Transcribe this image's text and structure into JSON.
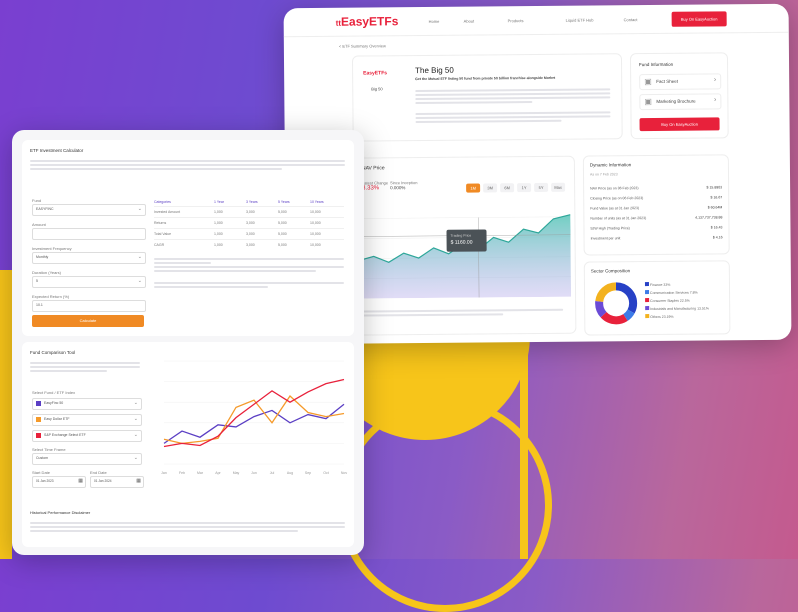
{
  "brand": {
    "name": "EasyETFs",
    "prefix": "tt"
  },
  "nav": {
    "items": [
      "Home",
      "About",
      "Products",
      "Liquid ETF Hub",
      "Contact"
    ],
    "cta": "Buy On EasyAuction"
  },
  "breadcrumb": "< ETF Summary Overview",
  "fund": {
    "logo_text": "EasyETFs",
    "ticker": "Big 50",
    "title": "The Big 50",
    "subtitle": "Get the Mutual ETF listing 50 fund from private 50 billion franchise alongside Market"
  },
  "fund_info": {
    "title": "Fund Information",
    "links": [
      "Fact Sheet",
      "Marketing Brochure"
    ],
    "cta": "Buy On EasyAuction"
  },
  "price_panel": {
    "title": "NAV Price",
    "stats": [
      {
        "label": "Latest Change",
        "value": "3.33%"
      },
      {
        "label": "Since Inception",
        "value": "0.000%"
      }
    ],
    "ranges": [
      "1M",
      "3M",
      "6M",
      "1Y",
      "5Y",
      "Max"
    ],
    "tooltip_label": "Trading Price",
    "tooltip_value": "$ 1160.00"
  },
  "dynamic_info": {
    "title": "Dynamic Information",
    "date": "As on 7 Feb 2023",
    "rows": [
      {
        "label": "NAV Price (as on 06 Feb 2023)",
        "value": "$ 15.8903"
      },
      {
        "label": "Closing Price (as on 06 Feb 2023)",
        "value": "$ 16.67"
      },
      {
        "label": "Fund Value (as at 31 Jan 2023)",
        "value": "$ 60.64M"
      },
      {
        "label": "Number of units (as at 31 Jan 2023)",
        "value": "4,137,737,738.88"
      },
      {
        "label": "52W High (Trading Price)",
        "value": "$ 16.43"
      },
      {
        "label": "Investment per unit",
        "value": "$ 4.16"
      }
    ]
  },
  "sector": {
    "title": "Sector Composition",
    "items": [
      {
        "label": "Finance",
        "value": "33%",
        "color": "#2741c6"
      },
      {
        "label": "Communication Services",
        "value": "7.8%",
        "color": "#3c7be8"
      },
      {
        "label": "Consumer Staples",
        "value": "22.5%",
        "color": "#e8213b"
      },
      {
        "label": "Industrials and Manufacturing",
        "value": "13.51%",
        "color": "#6b4bd6"
      },
      {
        "label": "Others",
        "value": "23.19%",
        "color": "#f3b21f"
      }
    ]
  },
  "calculator": {
    "title": "ETF Investment Calculator",
    "fields": [
      {
        "label": "Fund",
        "value": "EASYFINC"
      },
      {
        "label": "Amount",
        "value": ""
      },
      {
        "label": "Investment Frequency",
        "value": "Monthly"
      },
      {
        "label": "Duration (Years)",
        "value": "5"
      },
      {
        "label": "Expected Return (%)",
        "value": "10.1"
      }
    ],
    "button": "Calculate",
    "table_headers": [
      "Categories",
      "1 Year",
      "3 Years",
      "5 Years",
      "10 Years"
    ],
    "table_rows": [
      [
        "Invested Amount",
        "1,000",
        "3,000",
        "5,000",
        "10,000"
      ],
      [
        "Returns",
        "1,000",
        "3,000",
        "5,000",
        "10,000"
      ],
      [
        "Total Value",
        "1,000",
        "3,000",
        "5,000",
        "10,000"
      ],
      [
        "CAGR",
        "1,000",
        "3,000",
        "5,000",
        "10,000"
      ]
    ]
  },
  "comparison": {
    "title": "Fund Comparison Tool",
    "select_label": "Select Fund / ETF Index",
    "funds": [
      {
        "name": "EasyFinc 50",
        "color": "#5b3fc4"
      },
      {
        "name": "Easy Dollar ETF",
        "color": "#f59a2a"
      },
      {
        "name": "S&P Exchange Select ETF",
        "color": "#e8213b"
      }
    ],
    "period_label": "Select Time Frame",
    "period_value": "Custom",
    "start_label": "Start Date",
    "start_value": "01 Jan 2023",
    "end_label": "End Date",
    "end_value": "01 Jan 2024",
    "footer_title": "Historical Performance Disclaimer"
  },
  "comparison_chart": {
    "type": "line",
    "x": [
      "Jan",
      "Feb",
      "Mar",
      "Apr",
      "May",
      "Jun",
      "Jul",
      "Aug",
      "Sep",
      "Oct",
      "Nov"
    ],
    "ylim": [
      0,
      100
    ],
    "series": [
      {
        "color": "#5b3fc4",
        "values": [
          20,
          32,
          26,
          38,
          36,
          46,
          52,
          40,
          48,
          44,
          58
        ]
      },
      {
        "color": "#f59a2a",
        "values": [
          24,
          20,
          22,
          25,
          55,
          62,
          40,
          66,
          50,
          46,
          49
        ]
      },
      {
        "color": "#e8213b",
        "values": [
          17,
          20,
          18,
          27,
          45,
          58,
          71,
          60,
          70,
          78,
          82
        ]
      }
    ]
  }
}
